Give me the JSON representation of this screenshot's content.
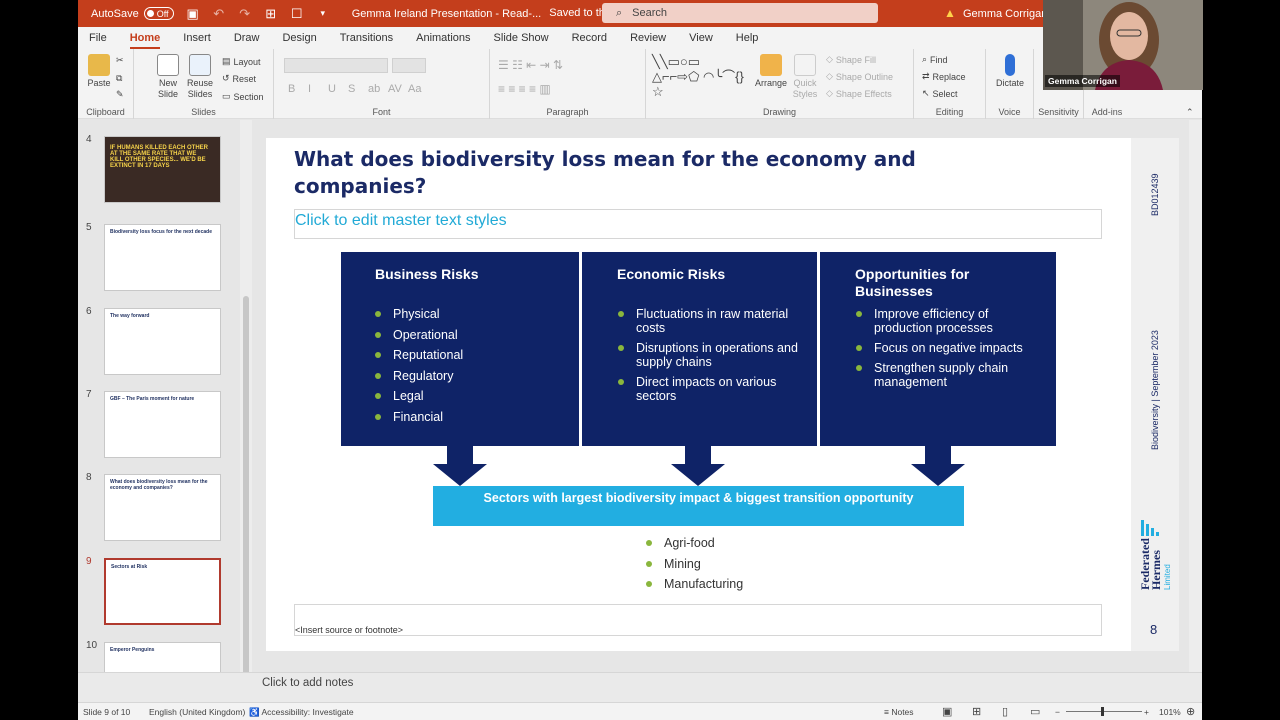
{
  "titlebar": {
    "autosave_label": "AutoSave",
    "autosave_state": "Off",
    "document_title": "Gemma Ireland Presentation  -  Read-...",
    "saved_status": "Saved to this PC ⌵",
    "search_placeholder": "Search",
    "user_name": "Gemma Corrigan"
  },
  "ribbon_tabs": [
    "File",
    "Home",
    "Insert",
    "Draw",
    "Design",
    "Transitions",
    "Animations",
    "Slide Show",
    "Record",
    "Review",
    "View",
    "Help"
  ],
  "ribbon": {
    "clipboard": {
      "paste": "Paste",
      "label": "Clipboard"
    },
    "slides": {
      "new_slide": "New Slide",
      "reuse_slides": "Reuse Slides",
      "layout": "Layout",
      "reset": "Reset",
      "section": "Section",
      "label": "Slides"
    },
    "font": {
      "label": "Font",
      "buttons": [
        "B",
        "I",
        "U",
        "S",
        "ab",
        "AV",
        "Aa"
      ]
    },
    "paragraph": {
      "label": "Paragraph"
    },
    "drawing": {
      "arrange": "Arrange",
      "quick_styles": "Quick Styles",
      "shape_fill": "Shape Fill",
      "shape_outline": "Shape Outline",
      "shape_effects": "Shape Effects",
      "label": "Drawing"
    },
    "editing": {
      "find": "Find",
      "replace": "Replace",
      "select": "Select",
      "label": "Editing"
    },
    "voice": {
      "dictate": "Dictate",
      "label": "Voice"
    },
    "sensitivity": {
      "label": "Sensitivity"
    },
    "addins": {
      "label": "Add-ins"
    }
  },
  "thumbnails": [
    {
      "number": "4",
      "title": "IF HUMANS KILLED EACH OTHER AT THE SAME RATE THAT WE KILL OTHER SPECIES... WE'D BE EXTINCT IN 17 DAYS"
    },
    {
      "number": "5",
      "title": "Biodiversity loss focus for the next decade"
    },
    {
      "number": "6",
      "title": "The way forward"
    },
    {
      "number": "7",
      "title": "GBF – The Paris moment for nature"
    },
    {
      "number": "8",
      "title": "What does biodiversity loss mean for the economy and companies?"
    },
    {
      "number": "9",
      "title": "Sectors at Risk"
    },
    {
      "number": "10",
      "title": "Emperor Penguins"
    }
  ],
  "slide": {
    "title": "What does biodiversity loss mean for the economy and companies?",
    "subtitle_placeholder": "Click to edit master text styles",
    "panels": [
      {
        "title": "Business Risks",
        "items": [
          "Physical",
          "Operational",
          "Reputational",
          "Regulatory",
          "Legal",
          "Financial"
        ]
      },
      {
        "title": "Economic Risks",
        "items": [
          "Fluctuations in raw material costs",
          "Disruptions in operations and supply chains",
          "Direct impacts on various sectors"
        ]
      },
      {
        "title": "Opportunities for Businesses",
        "items": [
          "Improve efficiency of production processes",
          "Focus on negative impacts",
          "Strengthen supply chain management"
        ]
      }
    ],
    "banner": "Sectors with largest biodiversity impact & biggest transition opportunity",
    "sectors": [
      "Agri-food",
      "Mining",
      "Manufacturing"
    ],
    "footnote": "<Insert source or footnote>",
    "side_code": "BD012439",
    "side_text": "Biodiversity  |  September 2023",
    "logo_line1": "Federated",
    "logo_line2": "Hermes",
    "logo_sub": "Limited",
    "page_number": "8"
  },
  "notes_placeholder": "Click to add notes",
  "statusbar": {
    "slide_info": "Slide 9 of 10",
    "language": "English (United Kingdom)",
    "accessibility": "Accessibility: Investigate",
    "notes_button": "Notes",
    "zoom": "101%"
  },
  "webcam": {
    "participant_name": "Gemma Corrigan"
  },
  "colors": {
    "accent": "#c43e1c",
    "navy": "#0f2367",
    "cyan": "#22aee1",
    "bullet_green": "#8ab63d"
  }
}
